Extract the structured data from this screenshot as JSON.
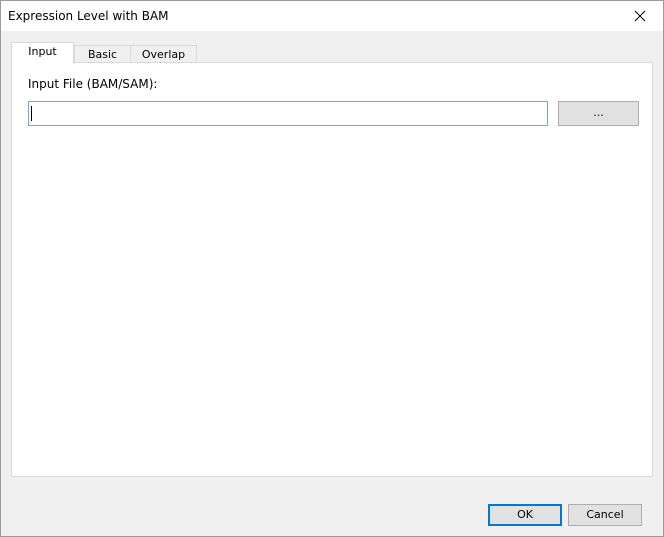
{
  "window": {
    "title": "Expression Level with BAM",
    "close_glyph": "close-icon"
  },
  "tabs": [
    {
      "label": "Input",
      "active": true
    },
    {
      "label": "Basic",
      "active": false
    },
    {
      "label": "Overlap",
      "active": false
    }
  ],
  "input_tab": {
    "file_label": "Input File (BAM/SAM):",
    "file_value": "",
    "browse_label": "..."
  },
  "footer": {
    "ok_label": "OK",
    "cancel_label": "Cancel"
  },
  "colors": {
    "window_bg": "#f0f0f0",
    "panel_bg": "#ffffff",
    "input_border_focus": "#7aa7d6",
    "button_bg": "#e1e1e1",
    "default_button_border": "#0078d7"
  }
}
